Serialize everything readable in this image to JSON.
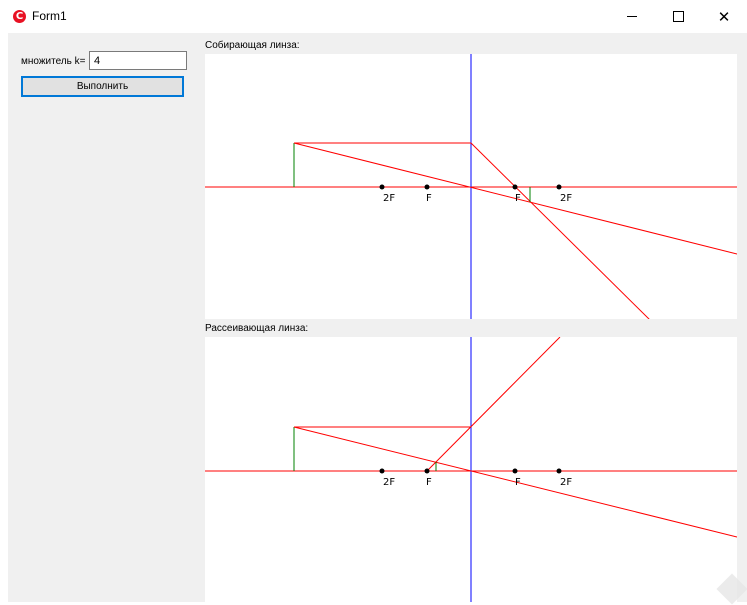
{
  "window": {
    "title": "Form1",
    "icon": "app-c-icon",
    "controls": [
      "minimize-icon",
      "maximize-icon",
      "close-icon"
    ],
    "close_glyph": "✕"
  },
  "form": {
    "k_label": "множитель k=",
    "k_value": "4",
    "run_label": "Выполнить"
  },
  "converging": {
    "label": "Собирающая линза:",
    "points": [
      "2F",
      "F",
      "F",
      "2F"
    ]
  },
  "diverging": {
    "label": "Рассеивающая линза:",
    "points": [
      "2F",
      "F",
      "F",
      "2F"
    ]
  },
  "colors": {
    "axis": "#ff0000",
    "lens": "#0000ff",
    "object": "#008000",
    "ray": "#ff0000",
    "panel_bg": "#ffffff",
    "form_bg": "#f0f0f0"
  }
}
